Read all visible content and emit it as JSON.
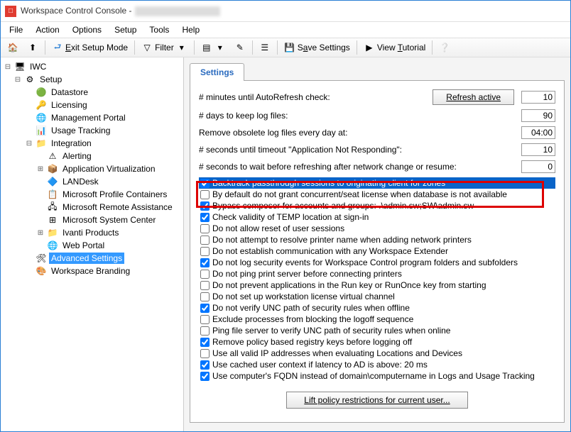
{
  "window": {
    "title": "Workspace Control Console -"
  },
  "menu": [
    "File",
    "Action",
    "Options",
    "Setup",
    "Tools",
    "Help"
  ],
  "toolbar": {
    "exit": "Exit Setup Mode",
    "filter": "Filter",
    "save": "Save Settings",
    "tutorial": "View Tutorial"
  },
  "tree": [
    {
      "d": 0,
      "exp": "−",
      "icon": "🖥",
      "label": "IWC"
    },
    {
      "d": 1,
      "exp": "−",
      "icon": "⚙",
      "label": "Setup"
    },
    {
      "d": 2,
      "exp": "",
      "icon": "🟢",
      "label": "Datastore"
    },
    {
      "d": 2,
      "exp": "",
      "icon": "🔑",
      "label": "Licensing"
    },
    {
      "d": 2,
      "exp": "",
      "icon": "🌐",
      "label": "Management Portal"
    },
    {
      "d": 2,
      "exp": "",
      "icon": "📊",
      "label": "Usage Tracking"
    },
    {
      "d": 2,
      "exp": "−",
      "icon": "📁",
      "label": "Integration"
    },
    {
      "d": 3,
      "exp": "",
      "icon": "⚠",
      "label": "Alerting"
    },
    {
      "d": 3,
      "exp": "+",
      "icon": "📦",
      "label": "Application Virtualization"
    },
    {
      "d": 3,
      "exp": "",
      "icon": "🔷",
      "label": "LANDesk"
    },
    {
      "d": 3,
      "exp": "",
      "icon": "📋",
      "label": "Microsoft Profile Containers"
    },
    {
      "d": 3,
      "exp": "",
      "icon": "🖧",
      "label": "Microsoft Remote Assistance"
    },
    {
      "d": 3,
      "exp": "",
      "icon": "⊞",
      "label": "Microsoft System Center"
    },
    {
      "d": 3,
      "exp": "+",
      "icon": "📁",
      "label": "Ivanti Products"
    },
    {
      "d": 3,
      "exp": "",
      "icon": "🌐",
      "label": "Web Portal"
    },
    {
      "d": 2,
      "exp": "",
      "icon": "🛠",
      "label": "Advanced Settings",
      "selected": true
    },
    {
      "d": 2,
      "exp": "",
      "icon": "🎨",
      "label": "Workspace Branding"
    }
  ],
  "tab": "Settings",
  "params": {
    "p1": {
      "label": "# minutes until AutoRefresh check:",
      "value": "10"
    },
    "p2": {
      "label": "# days to keep log files:",
      "value": "90"
    },
    "p3": {
      "label": "Remove obsolete log files every day at:",
      "value": "04:00"
    },
    "p4": {
      "label": "# seconds until timeout \"Application Not Responding\":",
      "value": "10"
    },
    "p5": {
      "label": "# seconds to wait before refreshing after network change or resume:",
      "value": "0"
    },
    "refresh": "Refresh active"
  },
  "checks": [
    {
      "c": true,
      "hl": true,
      "t": "Backtrack passthrough sessions to originating client for zones"
    },
    {
      "c": false,
      "t": "By default do not grant concurrent/seat license when database is not available"
    },
    {
      "c": true,
      "t": "Bypass composer for accounts and groups: .\\admin.sw;SW\\admin.sw"
    },
    {
      "c": true,
      "t": "Check validity of TEMP location at sign-in"
    },
    {
      "c": false,
      "t": "Do not allow reset of user sessions"
    },
    {
      "c": false,
      "t": "Do not attempt to resolve printer name when adding network printers"
    },
    {
      "c": false,
      "t": "Do not establish communication with any Workspace Extender"
    },
    {
      "c": true,
      "t": "Do not log security events for Workspace Control program folders and subfolders"
    },
    {
      "c": false,
      "t": "Do not ping print server before connecting printers"
    },
    {
      "c": false,
      "t": "Do not prevent applications in the Run key or RunOnce key from starting"
    },
    {
      "c": false,
      "t": "Do not set up workstation license virtual channel"
    },
    {
      "c": true,
      "t": "Do not verify UNC path of security rules when offline"
    },
    {
      "c": false,
      "t": "Exclude processes from blocking the logoff sequence"
    },
    {
      "c": false,
      "t": "Ping file server to verify UNC path of security rules when online"
    },
    {
      "c": true,
      "t": "Remove policy based registry keys before logging off"
    },
    {
      "c": false,
      "t": "Use all valid IP addresses when evaluating Locations and Devices"
    },
    {
      "c": true,
      "t": "Use cached user context if latency to AD is above: 20 ms"
    },
    {
      "c": true,
      "t": "Use computer's FQDN instead of domain\\computername in Logs and Usage Tracking"
    }
  ],
  "lift": "Lift policy restrictions for current user..."
}
